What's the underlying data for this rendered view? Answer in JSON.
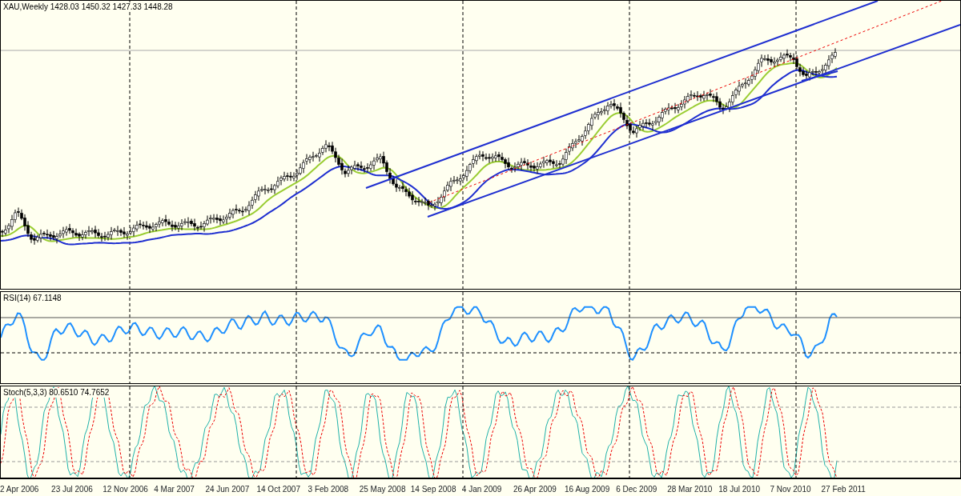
{
  "main_chart": {
    "title": "XAU,Weekly",
    "ohlc": "1428.03 1450.32 1427.33 1448.28"
  },
  "rsi_panel": {
    "label": "RSI(14) 67.1148"
  },
  "stoch_panel": {
    "label": "Stoch(5,3,3) 80.6510 74.7652"
  },
  "time_axis": {
    "labels": [
      "2 Apr 2006",
      "23 Jul 2006",
      "12 Nov 2006",
      "4 Mar 2007",
      "24 Jun 2007",
      "14 Oct 2007",
      "3 Feb 2008",
      "25 May 2008",
      "14 Sep 2008",
      "4 Jan 2009",
      "26 Apr 2009",
      "16 Aug 2009",
      "6 Dec 2009",
      "28 Mar 2010",
      "18 Jul 2010",
      "7 Nov 2010",
      "27 Feb 2011"
    ]
  }
}
